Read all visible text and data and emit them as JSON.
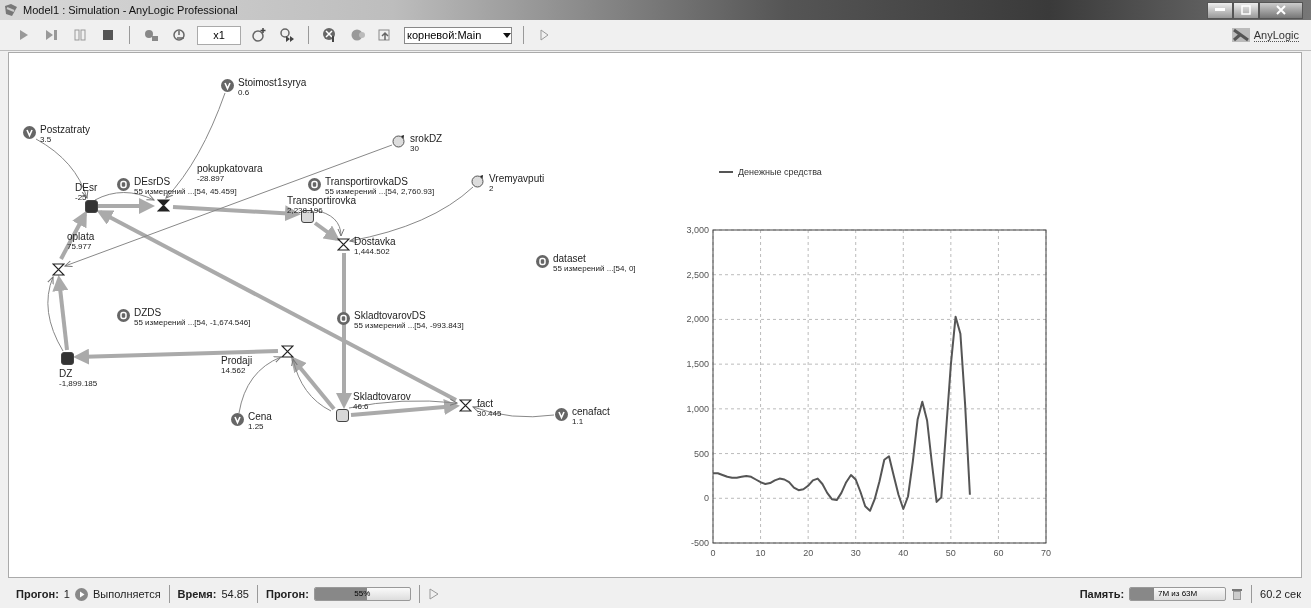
{
  "window": {
    "title": "Model1 : Simulation - AnyLogic Professional"
  },
  "toolbar": {
    "speed": "x1",
    "root": "корневой:Main",
    "brand": "AnyLogic"
  },
  "diagram": {
    "nodes": [
      {
        "kind": "variable",
        "name": "Stoimost1syrya",
        "value": "0.6"
      },
      {
        "kind": "variable",
        "name": "Postzatraty",
        "value": "3.5"
      },
      {
        "kind": "parameter",
        "name": "srokDZ",
        "value": "30"
      },
      {
        "kind": "flow",
        "name": "pokupkatovara",
        "value": "-28.897"
      },
      {
        "kind": "dataset",
        "name": "DEsrDS",
        "value": "55 измерений ...[54, 45.459]"
      },
      {
        "kind": "stock",
        "name": "DEsr",
        "value": "-25",
        "color": "#333333"
      },
      {
        "kind": "dataset",
        "name": "TransportirovkaDS",
        "value": "55 измерений ...[54, 2,760.93]"
      },
      {
        "kind": "stock",
        "name": "Transportirovka",
        "value": "2,238.196",
        "color": "#d8d8d8"
      },
      {
        "kind": "parameter",
        "name": "Vremyavputi",
        "value": "2"
      },
      {
        "kind": "flow",
        "name": "oplata",
        "value": "75.977"
      },
      {
        "kind": "flow",
        "name": "Dostavka",
        "value": "1,444.502"
      },
      {
        "kind": "dataset",
        "name": "dataset",
        "value": "55 измерений ...[54, 0]"
      },
      {
        "kind": "dataset",
        "name": "DZDS",
        "value": "55 измерений ...[54, -1,674.546]"
      },
      {
        "kind": "dataset",
        "name": "SkladtovarovDS",
        "value": "55 измерений ...[54, -993.843]"
      },
      {
        "kind": "flow",
        "name": "Prodaji",
        "value": "14.562"
      },
      {
        "kind": "stock",
        "name": "DZ",
        "value": "-1,899.185",
        "color": "#333333"
      },
      {
        "kind": "stock",
        "name": "Skladtovarov",
        "value": "46.6",
        "color": "#d8d8d8"
      },
      {
        "kind": "flow",
        "name": "fact",
        "value": "30.445"
      },
      {
        "kind": "variable",
        "name": "cenafact",
        "value": "1.1"
      },
      {
        "kind": "variable",
        "name": "Cena",
        "value": "1.25"
      }
    ]
  },
  "chart": {
    "chart_data": {
      "type": "line",
      "x": [
        0,
        1,
        2,
        3,
        4,
        5,
        6,
        7,
        8,
        9,
        10,
        11,
        12,
        13,
        14,
        15,
        16,
        17,
        18,
        19,
        20,
        21,
        22,
        23,
        24,
        25,
        26,
        27,
        28,
        29,
        30,
        31,
        32,
        33,
        34,
        35,
        36,
        37,
        38,
        39,
        40,
        41,
        42,
        43,
        44,
        45,
        46,
        47,
        48,
        49,
        50,
        51,
        52,
        53,
        54
      ],
      "series": [
        {
          "name": "Денежные средства",
          "color": "#555555",
          "values": [
            280,
            280,
            260,
            240,
            230,
            230,
            240,
            250,
            240,
            210,
            180,
            160,
            170,
            200,
            220,
            210,
            180,
            120,
            90,
            100,
            140,
            200,
            220,
            160,
            60,
            -10,
            -20,
            60,
            180,
            260,
            210,
            70,
            -90,
            -140,
            -10,
            190,
            430,
            470,
            250,
            40,
            -120,
            20,
            410,
            880,
            1080,
            870,
            400,
            -40,
            10,
            760,
            1500,
            2030,
            1840,
            1050,
            40
          ]
        }
      ],
      "grid": true,
      "xlim": [
        0,
        70
      ],
      "ylim": [
        -500,
        3000
      ],
      "xticks": [
        0,
        10,
        20,
        30,
        40,
        50,
        60,
        70
      ],
      "yticks": [
        {
          "value": -500,
          "label": "-500"
        },
        {
          "value": 0,
          "label": "0"
        },
        {
          "value": 500,
          "label": "500"
        },
        {
          "value": 1000,
          "label": "1,000"
        },
        {
          "value": 1500,
          "label": "1,500"
        },
        {
          "value": 2000,
          "label": "2,000"
        },
        {
          "value": 2500,
          "label": "2,500"
        },
        {
          "value": 3000,
          "label": "3,000"
        }
      ]
    }
  },
  "status_bar": {
    "run_label": "Прогон:",
    "run_number": "1",
    "run_state": "Выполняется",
    "time_label": "Время:",
    "time": "54.85",
    "progress_label": "Прогон:",
    "progress": {
      "level": 0.55,
      "text": "55%"
    },
    "memory_label": "Память:",
    "memory": {
      "level": 0.25,
      "text": "7M из 63M"
    },
    "elapsed": "60.2 сек"
  }
}
